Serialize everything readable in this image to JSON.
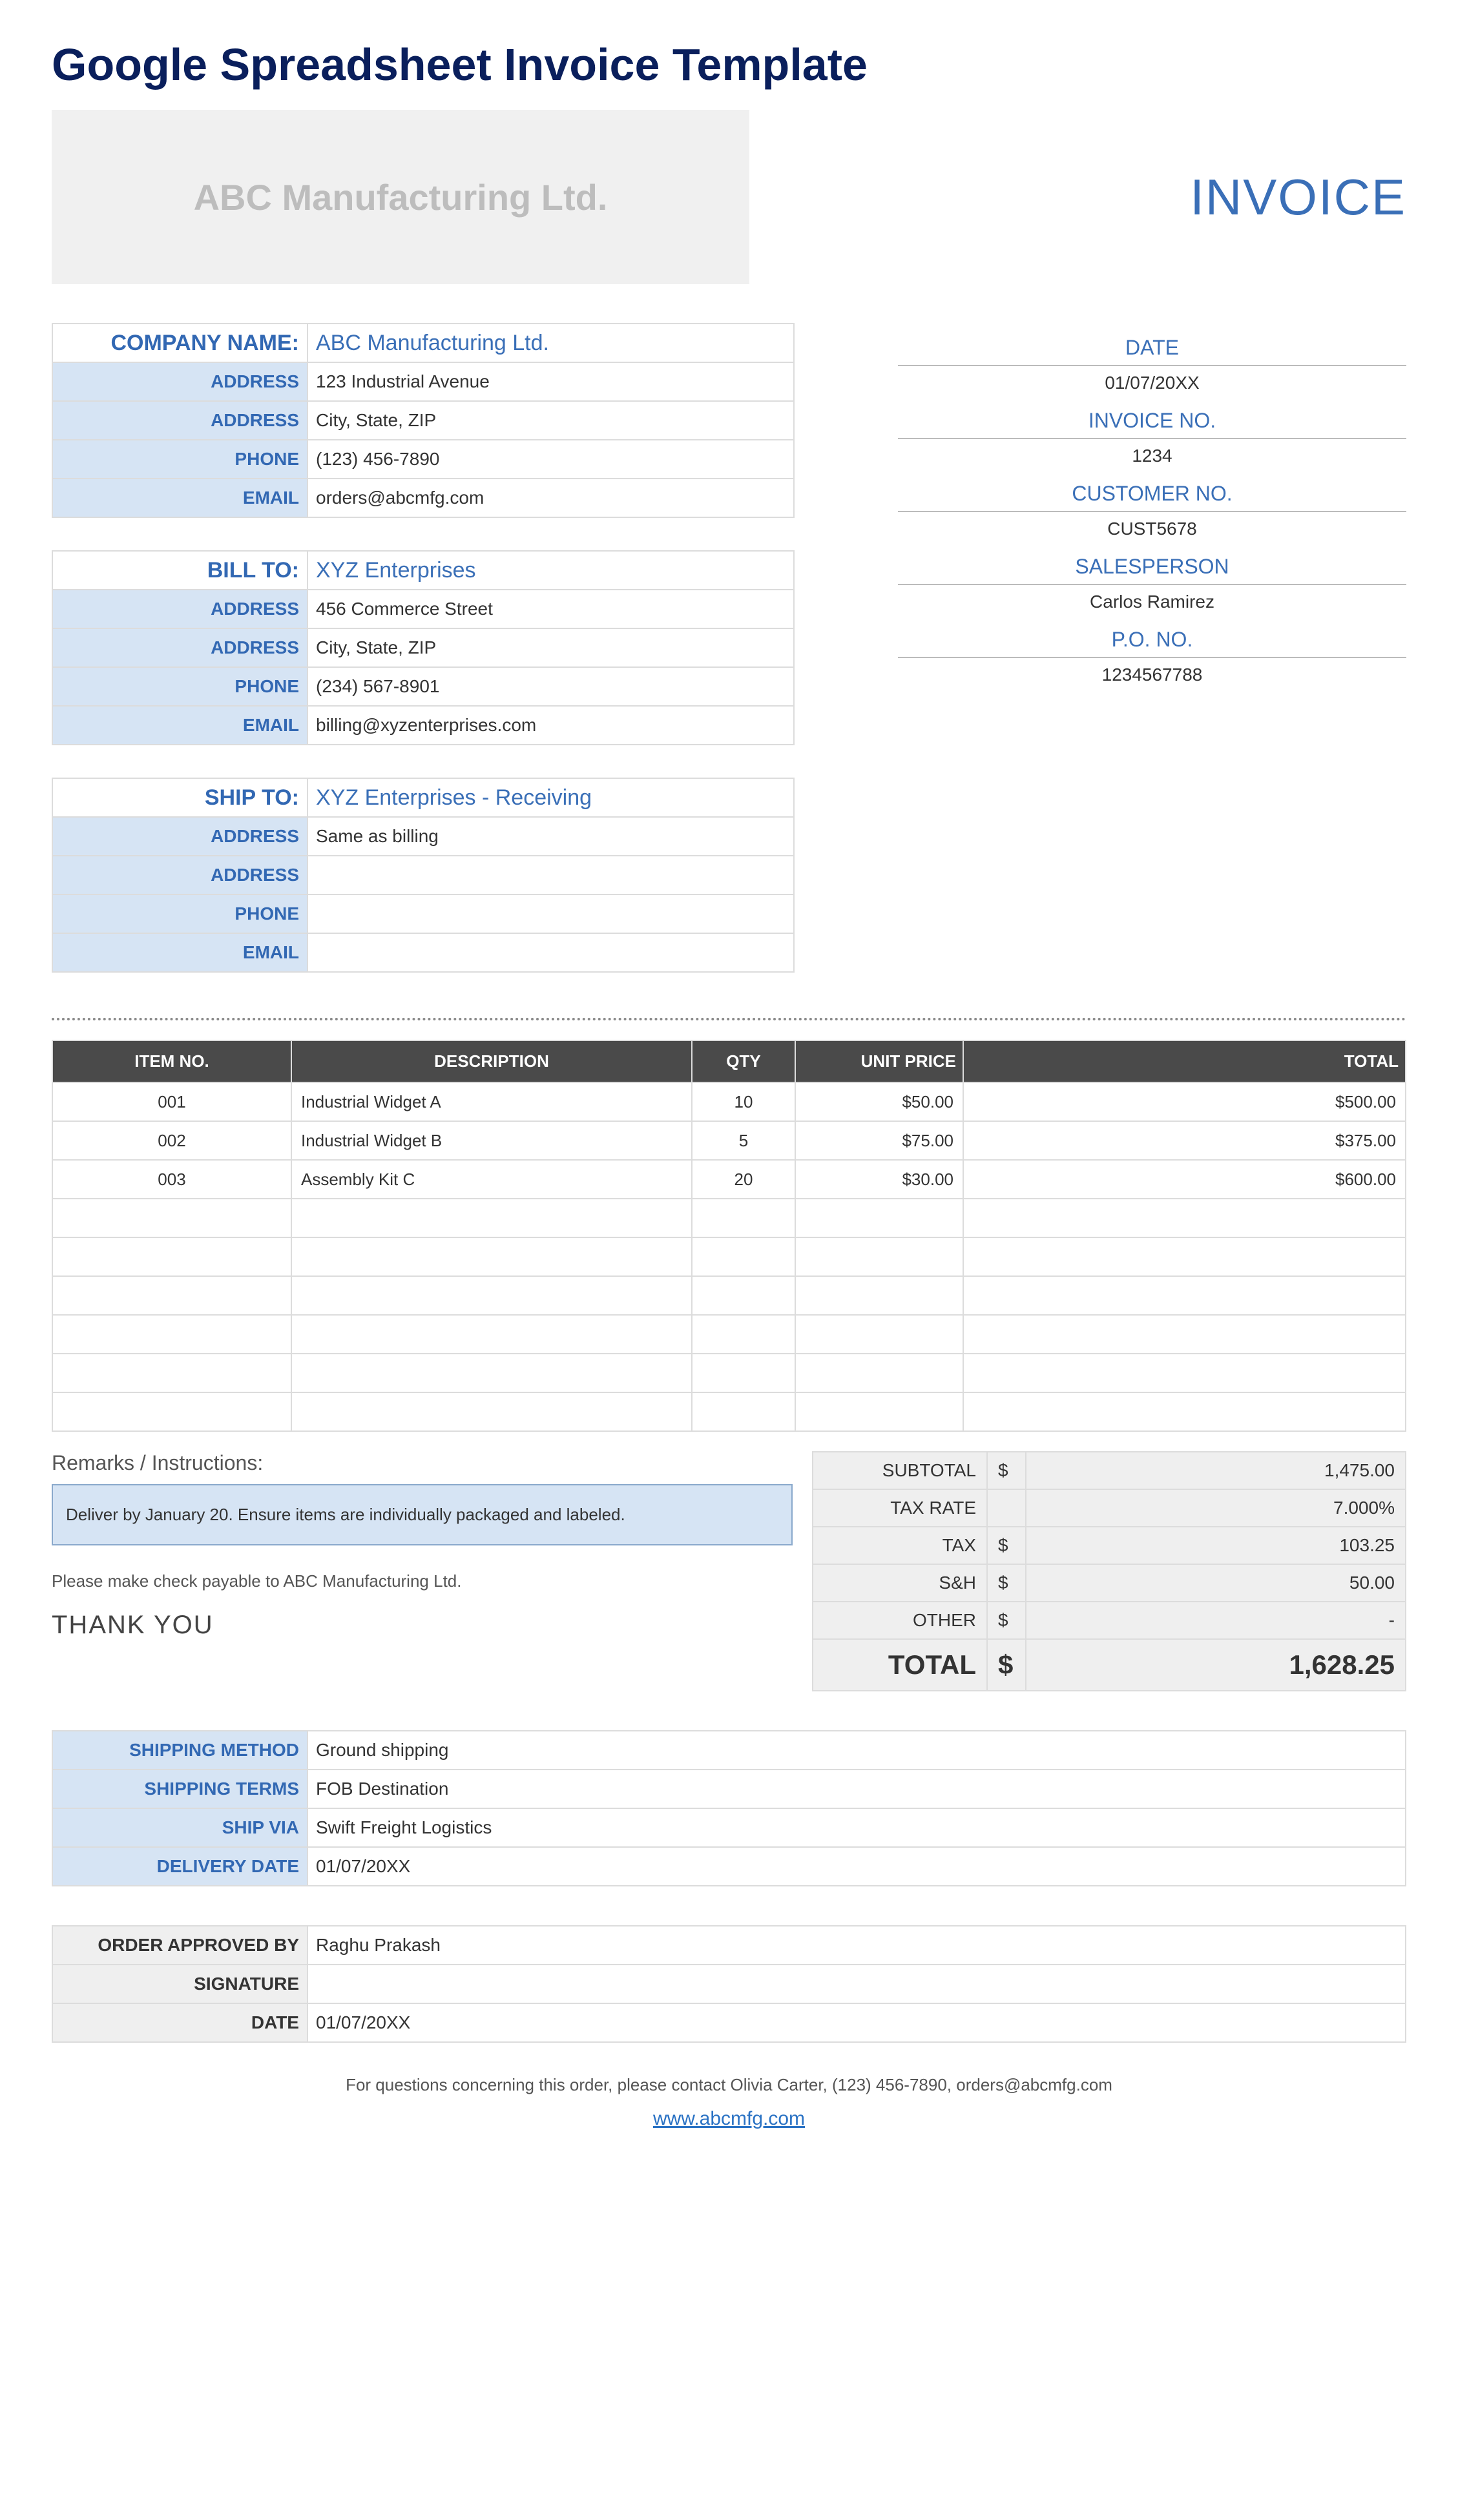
{
  "pageTitle": "Google Spreadsheet Invoice Template",
  "companyBox": "ABC Manufacturing Ltd.",
  "invoiceLabel": "INVOICE",
  "company": {
    "header": "COMPANY NAME:",
    "name": "ABC Manufacturing Ltd.",
    "rows": [
      {
        "label": "ADDRESS",
        "value": "123 Industrial Avenue"
      },
      {
        "label": "ADDRESS",
        "value": "City, State, ZIP"
      },
      {
        "label": "PHONE",
        "value": "(123) 456-7890"
      },
      {
        "label": "EMAIL",
        "value": "orders@abcmfg.com"
      }
    ]
  },
  "billTo": {
    "header": "BILL TO:",
    "name": "XYZ Enterprises",
    "rows": [
      {
        "label": "ADDRESS",
        "value": "456 Commerce Street"
      },
      {
        "label": "ADDRESS",
        "value": "City, State, ZIP"
      },
      {
        "label": "PHONE",
        "value": "(234) 567-8901"
      },
      {
        "label": "EMAIL",
        "value": "billing@xyzenterprises.com"
      }
    ]
  },
  "shipTo": {
    "header": "SHIP TO:",
    "name": "XYZ Enterprises - Receiving",
    "rows": [
      {
        "label": "ADDRESS",
        "value": "Same as billing"
      },
      {
        "label": "ADDRESS",
        "value": ""
      },
      {
        "label": "PHONE",
        "value": ""
      },
      {
        "label": "EMAIL",
        "value": ""
      }
    ]
  },
  "meta": [
    {
      "label": "DATE",
      "value": "01/07/20XX"
    },
    {
      "label": "INVOICE NO.",
      "value": "1234"
    },
    {
      "label": "CUSTOMER NO.",
      "value": "CUST5678"
    },
    {
      "label": "SALESPERSON",
      "value": "Carlos Ramirez"
    },
    {
      "label": "P.O. NO.",
      "value": "1234567788"
    }
  ],
  "itemsHeader": {
    "item": "ITEM NO.",
    "desc": "DESCRIPTION",
    "qty": "QTY",
    "price": "UNIT PRICE",
    "total": "TOTAL"
  },
  "items": [
    {
      "item": "001",
      "desc": "Industrial Widget A",
      "qty": "10",
      "price": "$50.00",
      "total": "$500.00"
    },
    {
      "item": "002",
      "desc": "Industrial Widget B",
      "qty": "5",
      "price": "$75.00",
      "total": "$375.00"
    },
    {
      "item": "003",
      "desc": "Assembly Kit C",
      "qty": "20",
      "price": "$30.00",
      "total": "$600.00"
    },
    {
      "item": "",
      "desc": "",
      "qty": "",
      "price": "",
      "total": ""
    },
    {
      "item": "",
      "desc": "",
      "qty": "",
      "price": "",
      "total": ""
    },
    {
      "item": "",
      "desc": "",
      "qty": "",
      "price": "",
      "total": ""
    },
    {
      "item": "",
      "desc": "",
      "qty": "",
      "price": "",
      "total": ""
    },
    {
      "item": "",
      "desc": "",
      "qty": "",
      "price": "",
      "total": ""
    },
    {
      "item": "",
      "desc": "",
      "qty": "",
      "price": "",
      "total": ""
    }
  ],
  "remarksTitle": "Remarks / Instructions:",
  "remarksText": "Deliver by January 20. Ensure items are individually packaged and labeled.",
  "payable": "Please make check payable to ABC Manufacturing Ltd.",
  "thankyou": "THANK YOU",
  "totals": [
    {
      "label": "SUBTOTAL",
      "sym": "$",
      "value": "1,475.00"
    },
    {
      "label": "TAX RATE",
      "sym": "",
      "value": "7.000%"
    },
    {
      "label": "TAX",
      "sym": "$",
      "value": "103.25"
    },
    {
      "label": "S&H",
      "sym": "$",
      "value": "50.00"
    },
    {
      "label": "OTHER",
      "sym": "$",
      "value": "-"
    }
  ],
  "grandTotal": {
    "label": "TOTAL",
    "sym": "$",
    "value": "1,628.25"
  },
  "shipping": [
    {
      "label": "SHIPPING METHOD",
      "value": "Ground shipping"
    },
    {
      "label": "SHIPPING TERMS",
      "value": "FOB Destination"
    },
    {
      "label": "SHIP VIA",
      "value": "Swift Freight Logistics"
    },
    {
      "label": "DELIVERY DATE",
      "value": "01/07/20XX"
    }
  ],
  "approval": [
    {
      "label": "ORDER APPROVED BY",
      "value": "Raghu Prakash"
    },
    {
      "label": "SIGNATURE",
      "value": ""
    },
    {
      "label": "DATE",
      "value": "01/07/20XX"
    }
  ],
  "footerText": "For questions concerning this order, please contact Olivia Carter, (123) 456-7890, orders@abcmfg.com",
  "footerLink": "www.abcmfg.com"
}
